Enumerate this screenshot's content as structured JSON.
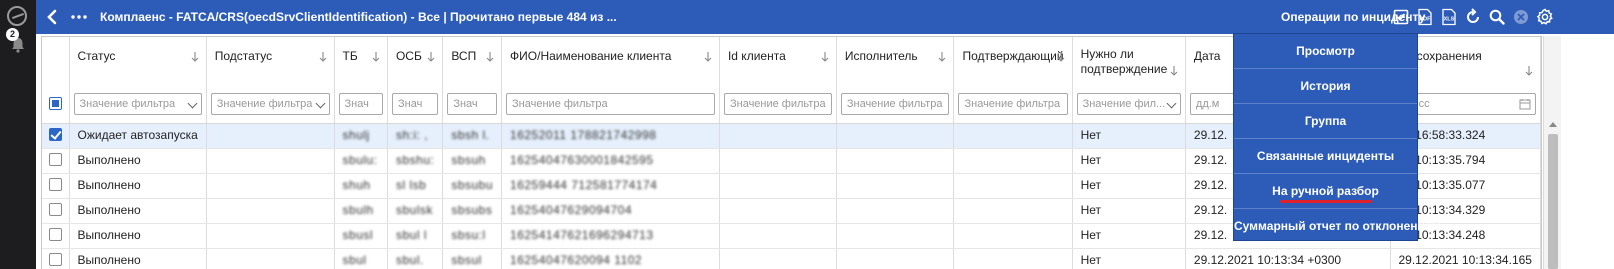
{
  "rail": {
    "notification_count": "2"
  },
  "topbar": {
    "title": "Комплаенс - FATCA/CRS(oecdSrvClientIdentification) - Все | Прочитано первые 484 из ...",
    "operations_label": "Операции по инциденту",
    "icons": [
      "back-icon",
      "more-icon",
      "checkbox-icon",
      "pdf-icon",
      "xls-icon",
      "refresh-icon",
      "search-icon",
      "close-icon",
      "settings-icon"
    ],
    "pdf_label": "PDF",
    "xls_label": "XLS"
  },
  "table": {
    "headers": {
      "status": "Статус",
      "substatus": "Подстатус",
      "tb": "ТБ",
      "osb": "ОСБ",
      "vsp": "ВСП",
      "client": "ФИО/Наименование клиента",
      "client_id": "Id клиента",
      "executor": "Исполнитель",
      "confirmer": "Подтверждающий",
      "need_confirm": "Нужно ли подтверждение",
      "date": "Дата",
      "save_time": "мя сохранения"
    },
    "filters": {
      "status": "Значение фильтра",
      "substatus": "Значение фильтра",
      "tb": "Знач",
      "osb": "Знач",
      "vsp": "Знач",
      "client": "Значение фильтра",
      "client_id": "Значение фильтра",
      "executor": "Значение фильтра",
      "confirmer": "Значение фильтра",
      "need_confirm": "Значение фил...",
      "date": "дд.м",
      "save_time": "мм:сс"
    },
    "rows": [
      {
        "checked": true,
        "status": "Ожидает автозапуска",
        "tb": "shulj",
        "osb": "sh:i: ,",
        "vsp": "sbsh l.",
        "client": "16252011 178821742998",
        "need_confirm": "Нет",
        "date": "29.12.",
        "save_time": "21 16:58:33.324"
      },
      {
        "checked": false,
        "status": "Выполнено",
        "tb": "sbulu:",
        "osb": "sbshu:",
        "vsp": "sbsuh",
        "client": "16254047630001842595",
        "need_confirm": "Нет",
        "date": "29.12.",
        "save_time": "21 10:13:35.794"
      },
      {
        "checked": false,
        "status": "Выполнено",
        "tb": "shuh",
        "osb": "sl lsb",
        "vsp": "sbsubu",
        "client": "16259444 712581774174",
        "need_confirm": "Нет",
        "date": "29.12.",
        "save_time": "21 10:13:35.077"
      },
      {
        "checked": false,
        "status": "Выполнено",
        "tb": "sbulh",
        "osb": "sbulsk",
        "vsp": "sbsubs",
        "client": "16254047629094704",
        "need_confirm": "Нет",
        "date": "29.12.",
        "save_time": "21 10:13:34.329"
      },
      {
        "checked": false,
        "status": "Выполнено",
        "tb": "sbusl",
        "osb": "sbul l",
        "vsp": "sbsu:l",
        "client": "16254147621696294713",
        "need_confirm": "Нет",
        "date": "29.12.",
        "save_time": "21 10:13:34.248"
      },
      {
        "checked": false,
        "status": "Выполнено",
        "tb": "sbul",
        "osb": "sbul.",
        "vsp": "sbsul",
        "client": "16254047620094 1102",
        "need_confirm": "Нет",
        "date": "29.12.2021 10:13:34 +0300",
        "save_time": "29.12.2021 10:13:34.165"
      }
    ]
  },
  "menu": {
    "items": [
      {
        "label": "Просмотр"
      },
      {
        "label": "История"
      },
      {
        "label": "Группа"
      },
      {
        "label": "Связанные инциденты"
      },
      {
        "label": "На ручной разбор"
      },
      {
        "label": "Суммарный отчет по отклонениям"
      }
    ],
    "highlighted_index": 4,
    "highlight_color": "#e0202a"
  },
  "colors": {
    "topbar": "#2c5cb8",
    "rail": "#1d1d1f",
    "selected_row": "#e6f0fc",
    "checkbox_accent": "#2c67c8"
  }
}
